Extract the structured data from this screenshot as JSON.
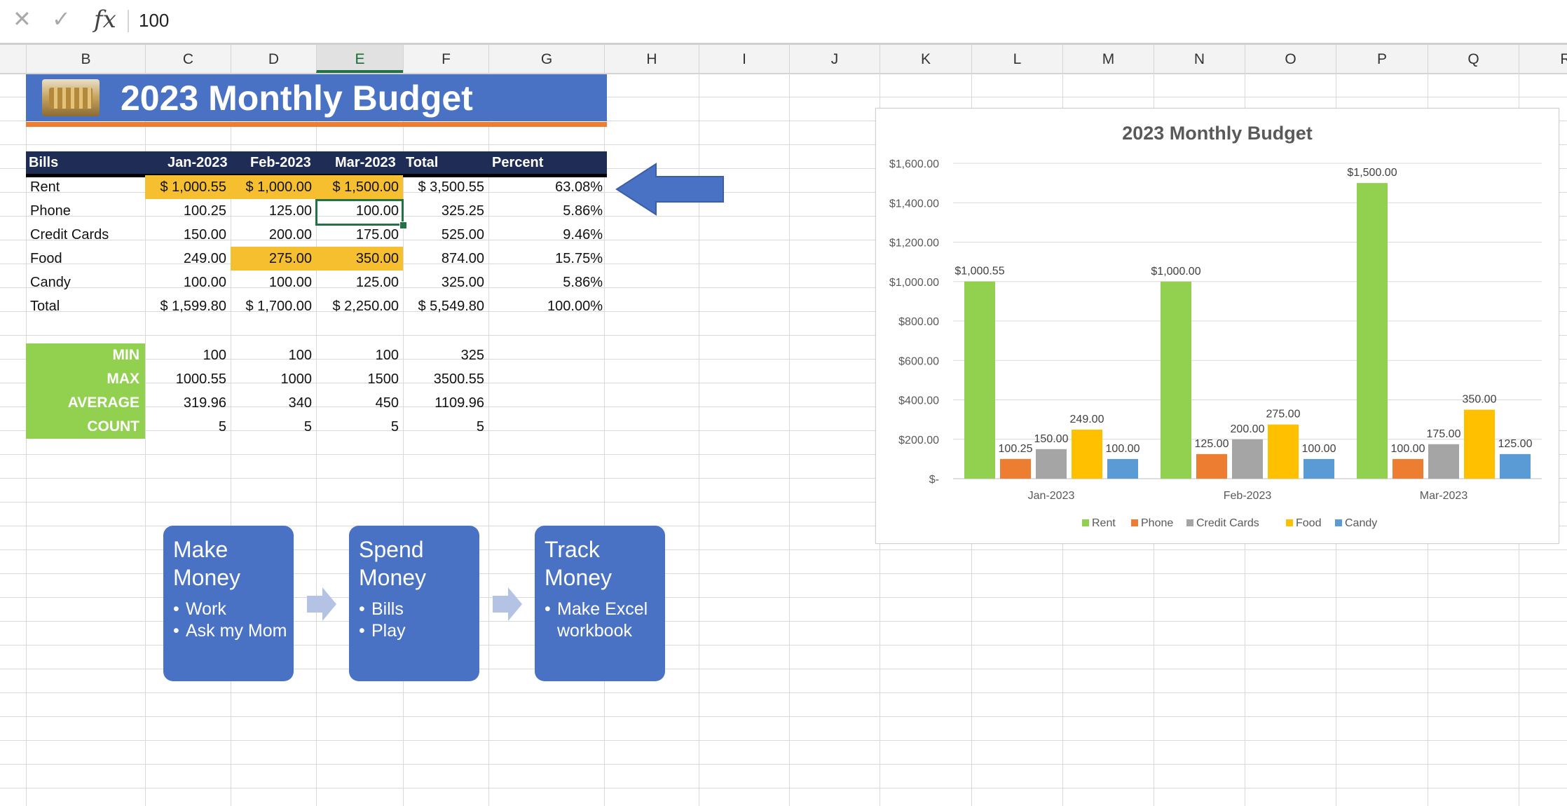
{
  "formula_bar": {
    "cancel_icon": "x-icon",
    "confirm_icon": "check-icon",
    "fx_label": "fx",
    "value": "100"
  },
  "columns": [
    "B",
    "C",
    "D",
    "E",
    "F",
    "G",
    "H",
    "I",
    "J",
    "K",
    "L",
    "M",
    "N",
    "O",
    "P",
    "Q",
    "R"
  ],
  "active_column": "E",
  "banner": {
    "title": "2023 Monthly Budget",
    "image": "coins-image"
  },
  "table": {
    "headers": [
      "Bills",
      "Jan-2023",
      "Feb-2023",
      "Mar-2023",
      "Total",
      "Percent"
    ],
    "rows": [
      [
        "Rent",
        "$ 1,000.55",
        "$ 1,000.00",
        "$ 1,500.00",
        "$ 3,500.55",
        "63.08%"
      ],
      [
        "Phone",
        "100.25",
        "125.00",
        "100.00",
        "325.25",
        "5.86%"
      ],
      [
        "Credit Cards",
        "150.00",
        "200.00",
        "175.00",
        "525.00",
        "9.46%"
      ],
      [
        "Food",
        "249.00",
        "275.00",
        "350.00",
        "874.00",
        "15.75%"
      ],
      [
        "Candy",
        "100.00",
        "100.00",
        "125.00",
        "325.00",
        "5.86%"
      ],
      [
        "Total",
        "$ 1,599.80",
        "$ 1,700.00",
        "$ 2,250.00",
        "$ 5,549.80",
        "100.00%"
      ]
    ],
    "highlight_color": "#f6bf2f",
    "header_color": "#1f2d56"
  },
  "stats": [
    {
      "label": "MIN",
      "values": [
        "100",
        "100",
        "100",
        "325"
      ]
    },
    {
      "label": "MAX",
      "values": [
        "1000.55",
        "1000",
        "1500",
        "3500.55"
      ]
    },
    {
      "label": "AVERAGE",
      "values": [
        "319.96",
        "340",
        "450",
        "1109.96"
      ]
    },
    {
      "label": "COUNT",
      "values": [
        "5",
        "5",
        "5",
        "5"
      ]
    }
  ],
  "stats_color": "#92d050",
  "arrow_color": "#4a72c4",
  "smartart": [
    {
      "title": "Make Money",
      "bullets": [
        "Work",
        "Ask my Mom"
      ]
    },
    {
      "title": "Spend Money",
      "bullets": [
        "Bills",
        "Play"
      ]
    },
    {
      "title": "Track Money",
      "bullets": [
        "Make Excel workbook"
      ]
    }
  ],
  "chart_data": {
    "type": "bar",
    "title": "2023 Monthly Budget",
    "categories": [
      "Jan-2023",
      "Feb-2023",
      "Mar-2023"
    ],
    "series": [
      {
        "name": "Rent",
        "color": "#92d050",
        "values": [
          1000.55,
          1000.0,
          1500.0
        ],
        "labels": [
          "$1,000.55",
          "$1,000.00",
          "$1,500.00"
        ]
      },
      {
        "name": "Phone",
        "color": "#ed7d31",
        "values": [
          100.25,
          125.0,
          100.0
        ],
        "labels": [
          "100.25",
          "125.00",
          "100.00"
        ]
      },
      {
        "name": "Credit Cards",
        "color": "#a5a5a5",
        "values": [
          150.0,
          200.0,
          175.0
        ],
        "labels": [
          "150.00",
          "200.00",
          "175.00"
        ]
      },
      {
        "name": "Food",
        "color": "#ffc000",
        "values": [
          249.0,
          275.0,
          350.0
        ],
        "labels": [
          "249.00",
          "275.00",
          "350.00"
        ]
      },
      {
        "name": "Candy",
        "color": "#5b9bd5",
        "values": [
          100.0,
          100.0,
          125.0
        ],
        "labels": [
          "100.00",
          "100.00",
          "125.00"
        ]
      }
    ],
    "y_ticks": [
      "$-",
      "$200.00",
      "$400.00",
      "$600.00",
      "$800.00",
      "$1,000.00",
      "$1,200.00",
      "$1,400.00",
      "$1,600.00"
    ],
    "ylim": [
      0,
      1600
    ],
    "grid": true,
    "legend_position": "bottom"
  }
}
